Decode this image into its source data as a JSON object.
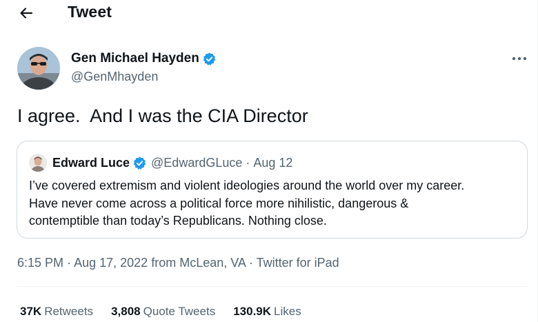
{
  "header": {
    "title": "Tweet",
    "back_icon": "arrow-left-icon"
  },
  "tweet": {
    "author_name": "Gen Michael Hayden",
    "author_handle": "@GenMhayden",
    "text": "I agree.  And I was the CIA Director",
    "time": "6:15 PM",
    "date": "Aug 17, 2022",
    "location": "from McLean, VA",
    "source": "Twitter for iPad",
    "separator": "·"
  },
  "quote": {
    "author_name": "Edward Luce",
    "author_handle": "@EdwardGLuce",
    "separator": "·",
    "date": "Aug 12",
    "lines": [
      "I’ve covered extremism and violent ideologies around the world over my career.",
      "Have never come across a political force more nihilistic, dangerous &",
      "contemptible than today’s Republicans. Nothing close."
    ]
  },
  "stats": {
    "retweets_count": "37K",
    "retweets_label": "Retweets",
    "quotes_count": "3,808",
    "quotes_label": "Quote Tweets",
    "likes_count": "130.9K",
    "likes_label": "Likes"
  },
  "colors": {
    "verified": "#1d9bf0",
    "secondary_text": "#536471",
    "primary_text": "#0f1419",
    "border": "#cfd9de"
  }
}
